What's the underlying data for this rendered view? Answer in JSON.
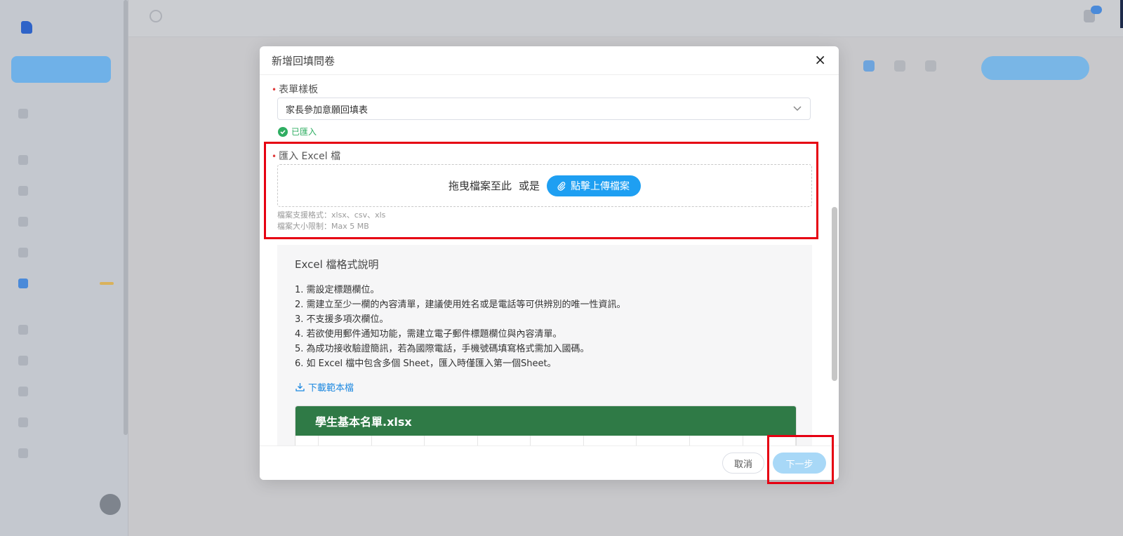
{
  "modal": {
    "title": "新增回填問卷",
    "close_label": "×",
    "template_field": {
      "label": "表單樣板",
      "selected": "家長參加意願回填表",
      "status": "已匯入"
    },
    "import_field": {
      "label": "匯入 Excel 檔",
      "drag_text": "拖曳檔案至此",
      "or_text": "或是",
      "upload_label": "點擊上傳檔案",
      "hint_formats": "檔案支援格式：xlsx、csv、xls",
      "hint_size": "檔案大小限制：Max 5 MB"
    },
    "info": {
      "title": "Excel 檔格式說明",
      "items": [
        "1. 需設定標題欄位。",
        "2. 需建立至少一欄的內容清單，建議使用姓名或是電話等可供辨別的唯一性資訊。",
        "3. 不支援多項次欄位。",
        "4. 若欲使用郵件通知功能，需建立電子郵件標題欄位與內容清單。",
        "5. 為成功接收驗證簡訊，若為國際電話，手機號碼填寫格式需加入國碼。",
        "6. 如 Excel 檔中包含多個 Sheet，匯入時僅匯入第一個Sheet。"
      ],
      "download_label": "下載範本檔",
      "preview_filename": "學生基本名單.xlsx"
    },
    "footer": {
      "cancel_label": "取消",
      "next_label": "下一步"
    }
  },
  "colors": {
    "primary": "#1e9ff2",
    "success": "#2fae62",
    "required": "#e03a3a",
    "highlight": "#e60012",
    "excel_green": "#2f7a46",
    "next_disabled": "#a8d8f7"
  },
  "icons": {
    "close": "close-icon",
    "chevron": "chevron-down-icon",
    "check": "check-circle-icon",
    "attach": "paperclip-icon",
    "download": "download-icon"
  }
}
